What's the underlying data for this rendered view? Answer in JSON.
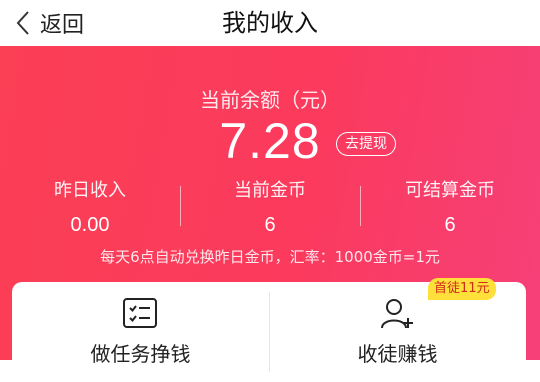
{
  "nav": {
    "back_label": "返回",
    "title": "我的收入"
  },
  "balance": {
    "label": "当前余额（元）",
    "value": "7.28",
    "withdraw_label": "去提现"
  },
  "stats": [
    {
      "label": "昨日收入",
      "value": "0.00"
    },
    {
      "label": "当前金币",
      "value": "6"
    },
    {
      "label": "可结算金币",
      "value": "6"
    }
  ],
  "rate_note": "每天6点自动兑换昨日金币，汇率：1000金币=1元",
  "actions": [
    {
      "label": "做任务挣钱",
      "icon": "checklist-icon"
    },
    {
      "label": "收徒赚钱",
      "icon": "add-user-icon",
      "badge": "首徒11元"
    }
  ],
  "colors": {
    "hero_start": "#fb3f55",
    "hero_end": "#f64078",
    "badge_bg": "#ffe03a",
    "badge_text": "#d02a1a"
  }
}
